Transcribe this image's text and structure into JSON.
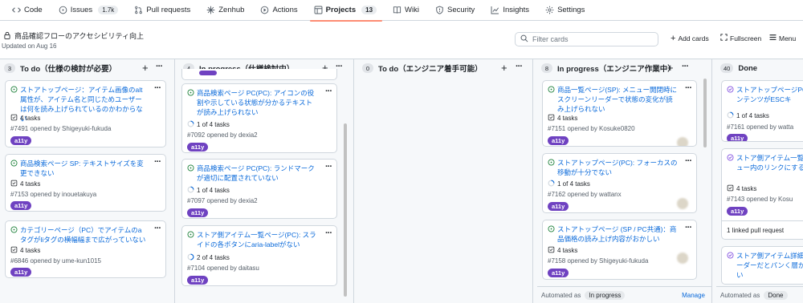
{
  "nav": {
    "items": [
      {
        "label": "Code",
        "icon": "code-icon"
      },
      {
        "label": "Issues",
        "icon": "issue-icon",
        "count": "1.7k"
      },
      {
        "label": "Pull requests",
        "icon": "pull-request-icon"
      },
      {
        "label": "Zenhub",
        "icon": "zenhub-icon"
      },
      {
        "label": "Actions",
        "icon": "play-icon"
      },
      {
        "label": "Projects",
        "icon": "table-icon",
        "count": "13"
      },
      {
        "label": "Wiki",
        "icon": "book-icon"
      },
      {
        "label": "Security",
        "icon": "shield-icon"
      },
      {
        "label": "Insights",
        "icon": "graph-icon"
      },
      {
        "label": "Settings",
        "icon": "gear-icon"
      }
    ]
  },
  "project": {
    "title": "商品確認フローのアクセシビリティ向上",
    "updated": "Updated on Aug 16",
    "filter_placeholder": "Filter cards",
    "add_cards": "Add cards",
    "fullscreen": "Fullscreen",
    "menu": "Menu"
  },
  "colors": {
    "accent": "#fd8c73",
    "link": "#0969da",
    "label_purple": "#6f42c1",
    "open_green": "#1a7f37"
  },
  "columns": [
    {
      "count": "3",
      "name": "To do（仕様の検討が必要）",
      "cards": [
        {
          "title": "ストアトップページ：アイテム画像のalt属性が、アイテム名と同じためユーザーは何を読み上げられているのかわからない",
          "tasks": "4 tasks",
          "meta": "#7491 opened by Shigeyuki-fukuda",
          "label": "a11y"
        },
        {
          "title": "商品検索ページ SP: テキストサイズを変更できない",
          "tasks": "4 tasks",
          "meta": "#7153 opened by inouetakuya",
          "label": "a11y"
        },
        {
          "title": "カテゴリーページ（PC）でアイテムのaタグがliタグの横幅幅まで広がっていない",
          "tasks": "4 tasks",
          "meta": "#6846 opened by ume-kun1015",
          "label": "a11y"
        }
      ]
    },
    {
      "count": "4",
      "name": "In progress（仕様検討中）",
      "cards": [
        {
          "title": "商品検索ページ PC(PC): アイコンの役割や示している状態が分かるテキストが読み上げられない",
          "tasks": "1 of 4 tasks",
          "meta": "#7092 opened by dexia2",
          "label": "a11y"
        },
        {
          "title": "商品検索ページ PC(PC): ランドマークが適切に配置されていない",
          "tasks": "1 of 4 tasks",
          "meta": "#7097 opened by dexia2",
          "label": "a11y"
        },
        {
          "title": "ストア側アイテム一覧ページ(PC): スライドの各ボタンにaria-labelがない",
          "tasks": "2 of 4 tasks",
          "meta": "#7104 opened by daitasu",
          "label": "a11y"
        }
      ]
    },
    {
      "count": "0",
      "name": "To do（エンジニア着手可能）",
      "cards": []
    },
    {
      "count": "8",
      "name": "In progress（エンジニア作業中）",
      "cards": [
        {
          "title": "商品一覧ページ(SP): メニュー開閉時にスクリーンリーダーで状態の変化が読み上げられない",
          "tasks": "4 tasks",
          "meta": "#7151 opened by Kosuke0820",
          "label": "a11y"
        },
        {
          "title": "ストアトップページ(PC): フォーカスの移動が十分でない",
          "tasks": "1 of 4 tasks",
          "meta": "#7162 opened by wattanx",
          "label": "a11y"
        },
        {
          "title": "ストアトップページ (SP / PC共通)：商品価格の読み上げ内容がおかしい",
          "tasks": "4 tasks",
          "meta": "#7158 opened by Shigeyuki-fukuda",
          "label": "a11y"
        }
      ],
      "automated_as": "Automated as",
      "automated_value": "In progress",
      "manage": "Manage"
    },
    {
      "count": "40",
      "name": "Done",
      "cards": [
        {
          "title": "ストアトップページPCれるコンテンツがESCキ",
          "tasks": "1 of 4 tasks",
          "meta": "#7161 opened by watta",
          "label": "a11y"
        },
        {
          "title": "ストア側アイテム一覧ペのメニュー内のリンクにする",
          "tasks": "4 tasks",
          "meta": "#7143 opened by Kosu",
          "label": "a11y",
          "linked": "1 linked pull request"
        },
        {
          "title": "ストア側アイテム詳細ペーンリーダーだとパンく層か分からない"
        }
      ],
      "automated_as": "Automated as",
      "automated_value": "Done"
    }
  ]
}
